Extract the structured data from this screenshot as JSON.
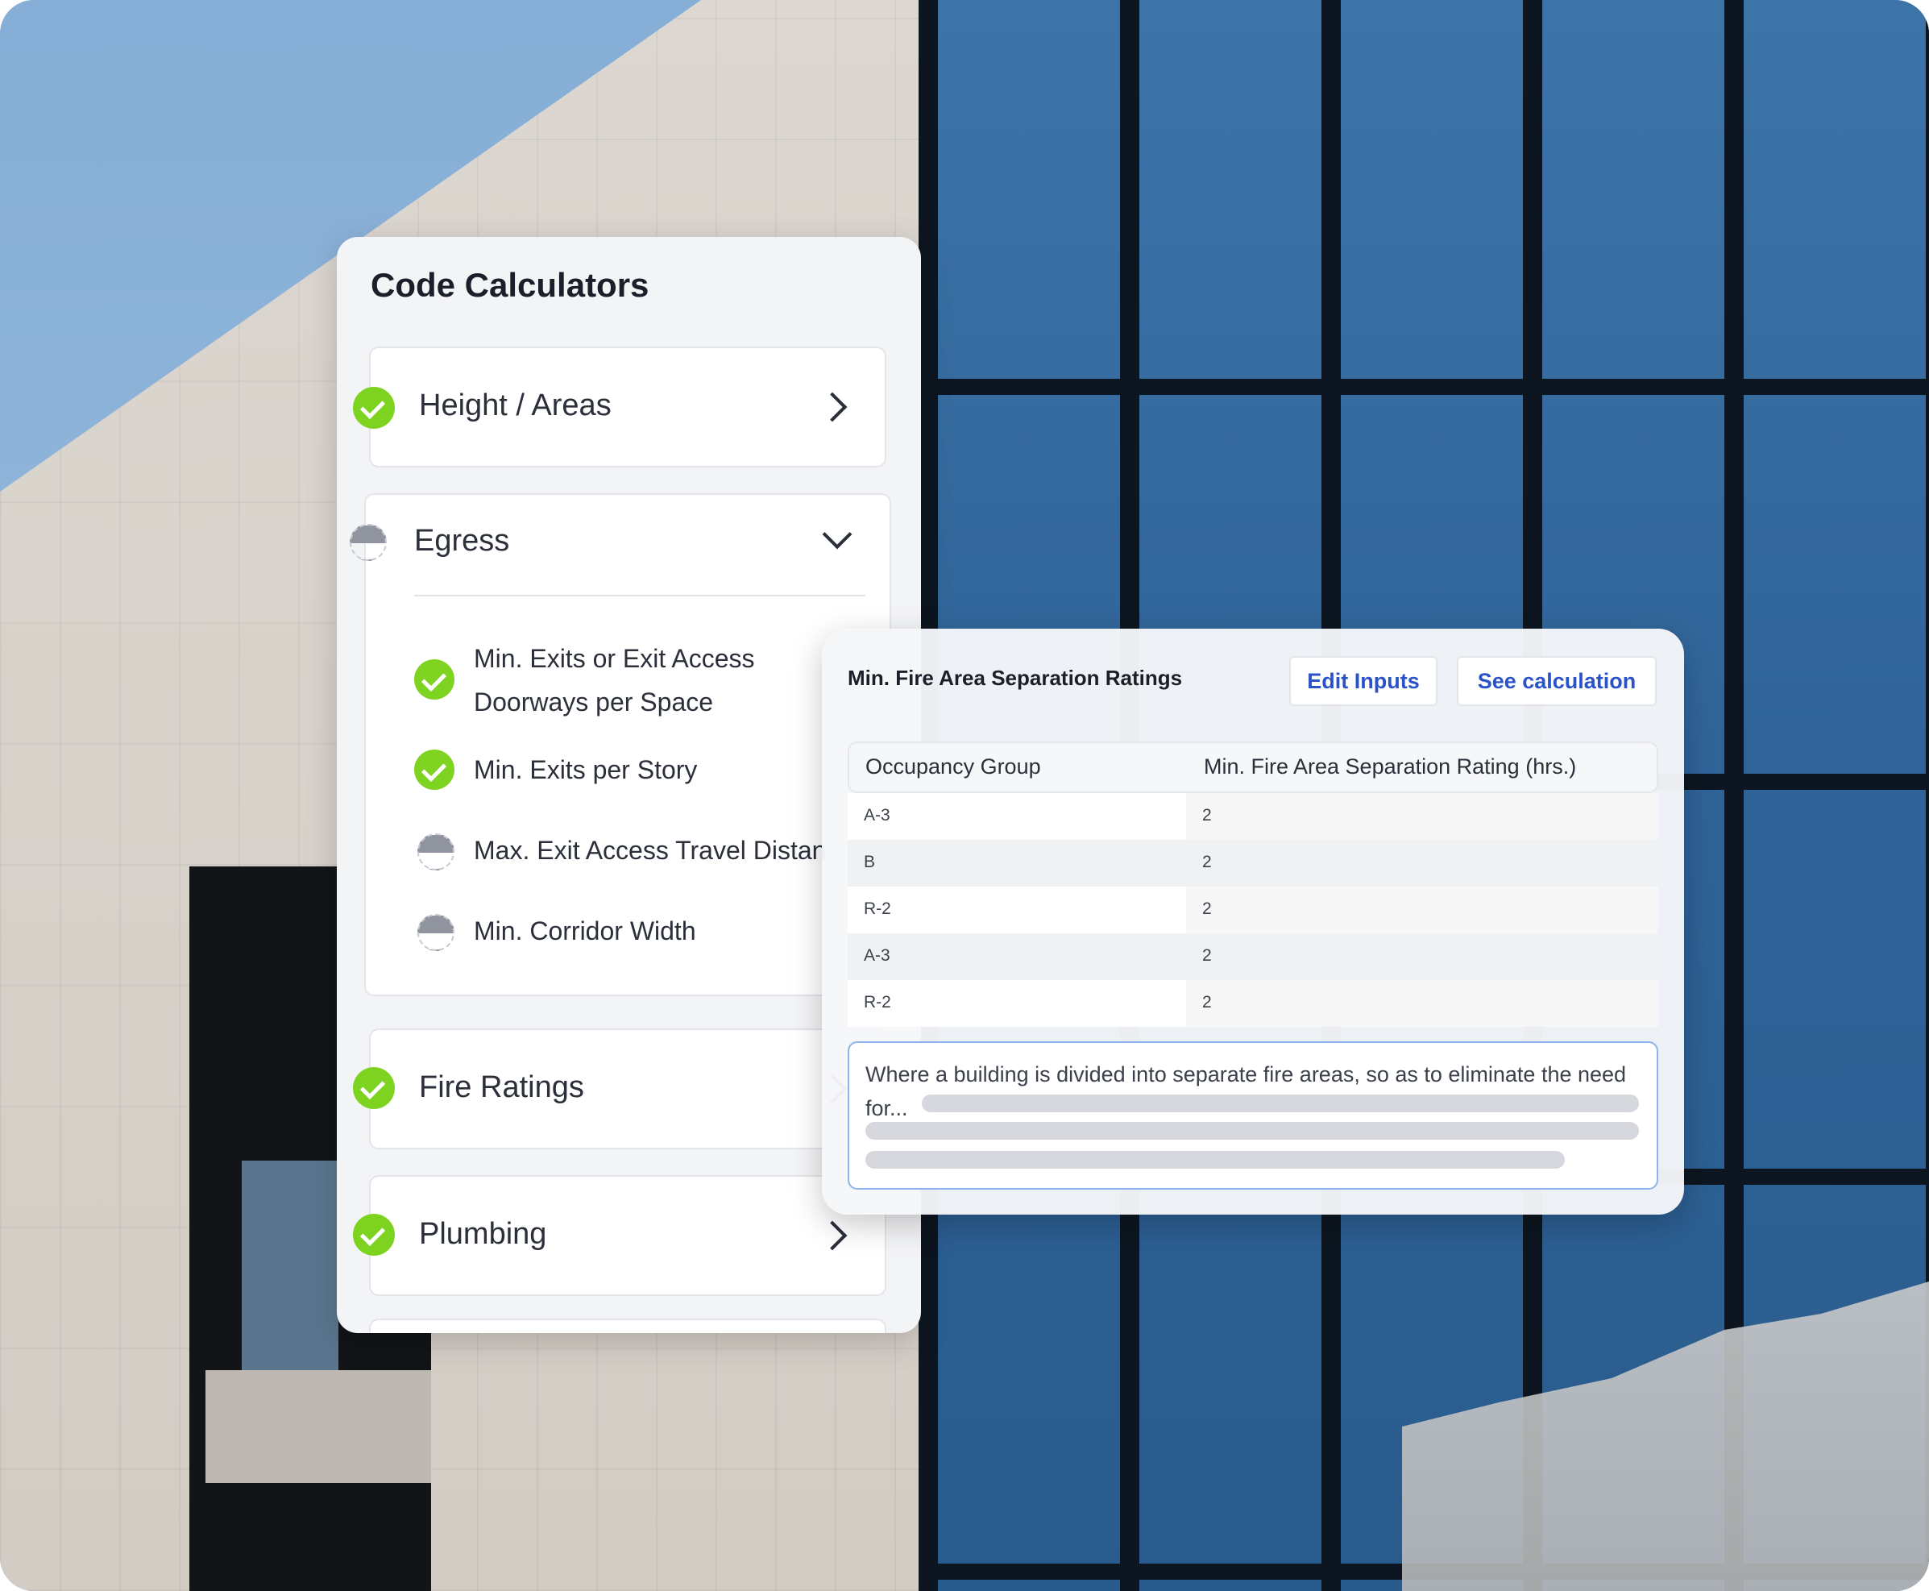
{
  "panel": {
    "title": "Code Calculators",
    "items": [
      {
        "label": "Height / Areas",
        "status": "complete",
        "expanded": false
      },
      {
        "label": "Egress",
        "status": "partial",
        "expanded": true,
        "subitems": [
          {
            "label_line1": "Min. Exits or Exit Access",
            "label_line2": "Doorways per Space",
            "status": "complete"
          },
          {
            "label": "Min. Exits per Story",
            "status": "complete"
          },
          {
            "label": "Max. Exit Access Travel Distan",
            "status": "partial"
          },
          {
            "label": "Min. Corridor Width",
            "status": "partial"
          }
        ]
      },
      {
        "label": "Fire Ratings",
        "status": "complete",
        "expanded": false
      },
      {
        "label": "Plumbing",
        "status": "complete",
        "expanded": false
      }
    ]
  },
  "result": {
    "title": "Min. Fire Area Separation Ratings",
    "edit_button": "Edit Inputs",
    "calc_button": "See calculation",
    "table": {
      "headers": [
        "Occupancy Group",
        "Min. Fire Area Separation Rating (hrs.)"
      ],
      "rows": [
        [
          "A-3",
          "2"
        ],
        [
          "B",
          "2"
        ],
        [
          "R-2",
          "2"
        ],
        [
          "A-3",
          "2"
        ],
        [
          "R-2",
          "2"
        ]
      ]
    },
    "note": "Where a building is divided into separate fire areas, so as to eliminate the need for..."
  },
  "colors": {
    "check": "#7ed321",
    "link": "#2b53c9",
    "note_border": "#8bb3ec"
  }
}
